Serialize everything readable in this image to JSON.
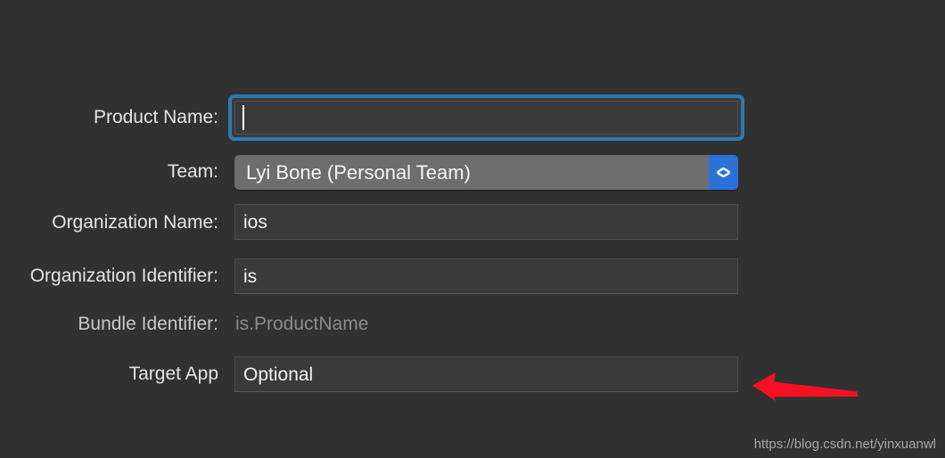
{
  "window": {
    "background_color": "#313131",
    "accent_color": "#2a72da",
    "focus_ring_color": "#2b7bb0",
    "annotation_color": "#f51022"
  },
  "form": {
    "rows": [
      {
        "label": "Product Name:",
        "type": "text-focused",
        "value": "",
        "placeholder": ""
      },
      {
        "label": "Team:",
        "type": "popup-button",
        "value": "Lyi Bone (Personal Team)"
      },
      {
        "label": "Organization Name:",
        "type": "text",
        "value": "ios"
      },
      {
        "label": "Organization Identifier:",
        "type": "text",
        "value": "is"
      },
      {
        "label": "Bundle Identifier:",
        "type": "static",
        "value": "is.ProductName"
      },
      {
        "label": "Target App",
        "type": "text",
        "value": "Optional"
      }
    ]
  },
  "annotation": {
    "arrow_icon": "arrow-left-icon",
    "direction": "left"
  },
  "watermark": {
    "text": "https://blog.csdn.net/yinxuanwl"
  }
}
